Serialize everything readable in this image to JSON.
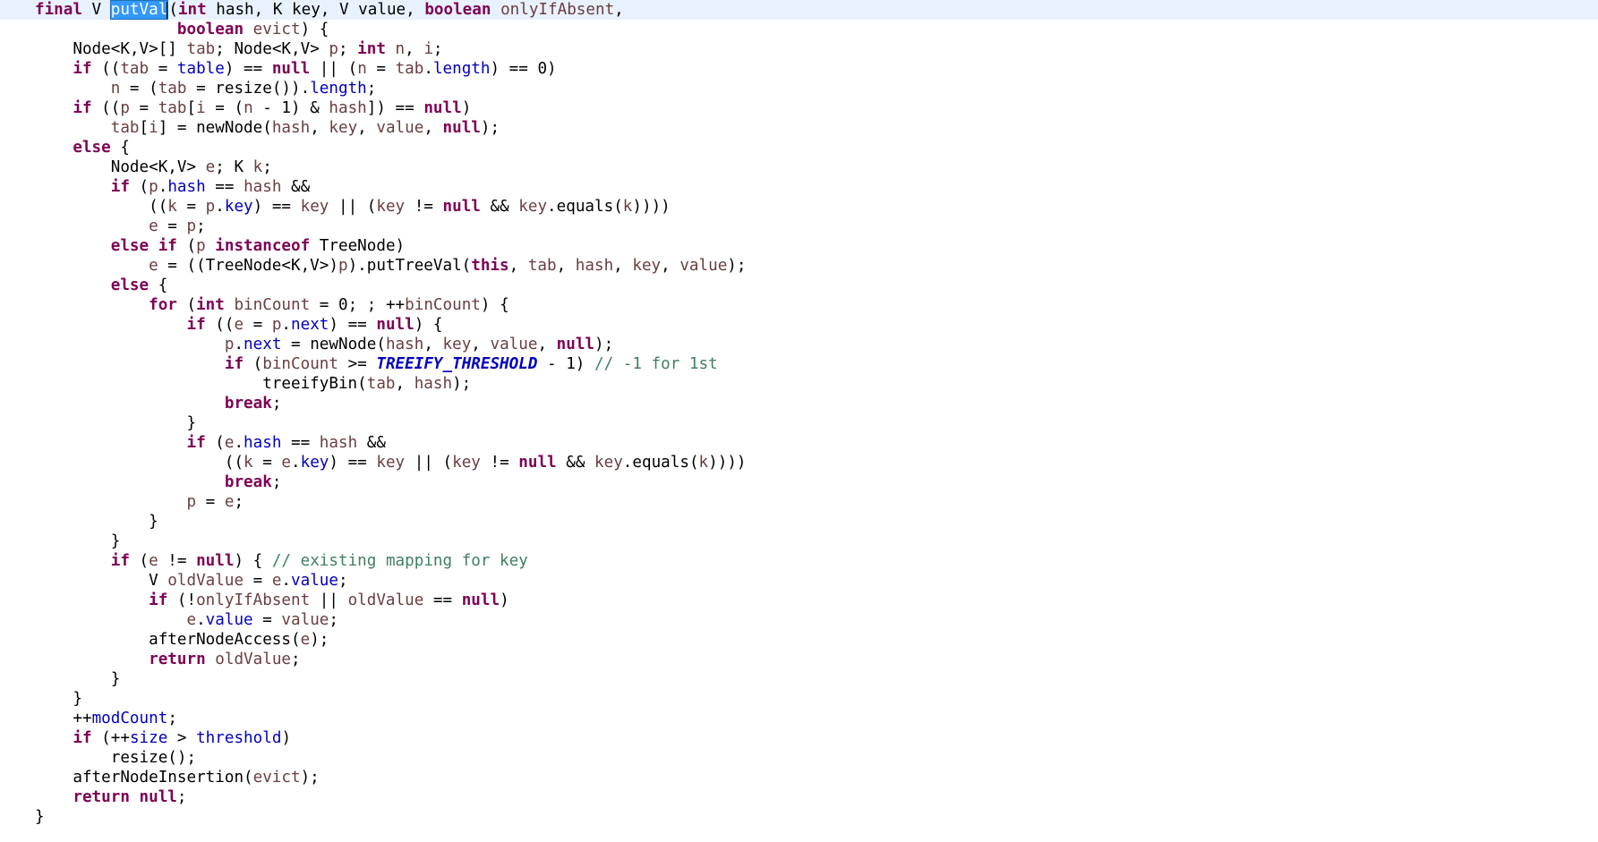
{
  "editor": {
    "colors": {
      "background": "#ffffff",
      "current_line": "#e8f2fe",
      "keyword": "#7f0055",
      "field": "#0000c0",
      "parameter": "#6a3e3e",
      "comment": "#3f7f5f",
      "selection": "#3399ff"
    },
    "current_line_index": 0,
    "selected_text": "putVal",
    "lines": [
      [
        {
          "t": "final",
          "c": "kw"
        },
        {
          "t": " V "
        },
        {
          "t": "putVal",
          "c": "sel"
        },
        {
          "t": "",
          "c": "caret"
        },
        {
          "t": "("
        },
        {
          "t": "int",
          "c": "kw"
        },
        {
          "t": " hash, K key, V value, "
        },
        {
          "t": "boolean",
          "c": "kw"
        },
        {
          "t": " "
        },
        {
          "t": "onlyIfAbsent",
          "c": "param"
        },
        {
          "t": ","
        }
      ],
      [
        {
          "t": "               "
        },
        {
          "t": "boolean",
          "c": "kw"
        },
        {
          "t": " "
        },
        {
          "t": "evict",
          "c": "param"
        },
        {
          "t": ") {"
        }
      ],
      [
        {
          "t": "    Node<K,V>[] "
        },
        {
          "t": "tab",
          "c": "param"
        },
        {
          "t": "; Node<K,V> "
        },
        {
          "t": "p",
          "c": "param"
        },
        {
          "t": "; "
        },
        {
          "t": "int",
          "c": "kw"
        },
        {
          "t": " "
        },
        {
          "t": "n",
          "c": "param"
        },
        {
          "t": ", "
        },
        {
          "t": "i",
          "c": "param"
        },
        {
          "t": ";"
        }
      ],
      [
        {
          "t": "    "
        },
        {
          "t": "if",
          "c": "kw"
        },
        {
          "t": " (("
        },
        {
          "t": "tab",
          "c": "param"
        },
        {
          "t": " = "
        },
        {
          "t": "table",
          "c": "field"
        },
        {
          "t": ") == "
        },
        {
          "t": "null",
          "c": "kw"
        },
        {
          "t": " || ("
        },
        {
          "t": "n",
          "c": "param"
        },
        {
          "t": " = "
        },
        {
          "t": "tab",
          "c": "param"
        },
        {
          "t": "."
        },
        {
          "t": "length",
          "c": "field"
        },
        {
          "t": ") == 0)"
        }
      ],
      [
        {
          "t": "        "
        },
        {
          "t": "n",
          "c": "param"
        },
        {
          "t": " = ("
        },
        {
          "t": "tab",
          "c": "param"
        },
        {
          "t": " = resize())."
        },
        {
          "t": "length",
          "c": "field"
        },
        {
          "t": ";"
        }
      ],
      [
        {
          "t": "    "
        },
        {
          "t": "if",
          "c": "kw"
        },
        {
          "t": " (("
        },
        {
          "t": "p",
          "c": "param"
        },
        {
          "t": " = "
        },
        {
          "t": "tab",
          "c": "param"
        },
        {
          "t": "["
        },
        {
          "t": "i",
          "c": "param"
        },
        {
          "t": " = ("
        },
        {
          "t": "n",
          "c": "param"
        },
        {
          "t": " - 1) & "
        },
        {
          "t": "hash",
          "c": "param"
        },
        {
          "t": "]) == "
        },
        {
          "t": "null",
          "c": "kw"
        },
        {
          "t": ")"
        }
      ],
      [
        {
          "t": "        "
        },
        {
          "t": "tab",
          "c": "param"
        },
        {
          "t": "["
        },
        {
          "t": "i",
          "c": "param"
        },
        {
          "t": "] = newNode("
        },
        {
          "t": "hash",
          "c": "param"
        },
        {
          "t": ", "
        },
        {
          "t": "key",
          "c": "param"
        },
        {
          "t": ", "
        },
        {
          "t": "value",
          "c": "param"
        },
        {
          "t": ", "
        },
        {
          "t": "null",
          "c": "kw"
        },
        {
          "t": ");"
        }
      ],
      [
        {
          "t": "    "
        },
        {
          "t": "else",
          "c": "kw"
        },
        {
          "t": " {"
        }
      ],
      [
        {
          "t": "        Node<K,V> "
        },
        {
          "t": "e",
          "c": "param"
        },
        {
          "t": "; K "
        },
        {
          "t": "k",
          "c": "param"
        },
        {
          "t": ";"
        }
      ],
      [
        {
          "t": "        "
        },
        {
          "t": "if",
          "c": "kw"
        },
        {
          "t": " ("
        },
        {
          "t": "p",
          "c": "param"
        },
        {
          "t": "."
        },
        {
          "t": "hash",
          "c": "field"
        },
        {
          "t": " == "
        },
        {
          "t": "hash",
          "c": "param"
        },
        {
          "t": " &&"
        }
      ],
      [
        {
          "t": "            (("
        },
        {
          "t": "k",
          "c": "param"
        },
        {
          "t": " = "
        },
        {
          "t": "p",
          "c": "param"
        },
        {
          "t": "."
        },
        {
          "t": "key",
          "c": "field"
        },
        {
          "t": ") == "
        },
        {
          "t": "key",
          "c": "param"
        },
        {
          "t": " || ("
        },
        {
          "t": "key",
          "c": "param"
        },
        {
          "t": " != "
        },
        {
          "t": "null",
          "c": "kw"
        },
        {
          "t": " && "
        },
        {
          "t": "key",
          "c": "param"
        },
        {
          "t": ".equals("
        },
        {
          "t": "k",
          "c": "param"
        },
        {
          "t": "))))"
        }
      ],
      [
        {
          "t": "            "
        },
        {
          "t": "e",
          "c": "param"
        },
        {
          "t": " = "
        },
        {
          "t": "p",
          "c": "param"
        },
        {
          "t": ";"
        }
      ],
      [
        {
          "t": "        "
        },
        {
          "t": "else",
          "c": "kw"
        },
        {
          "t": " "
        },
        {
          "t": "if",
          "c": "kw"
        },
        {
          "t": " ("
        },
        {
          "t": "p",
          "c": "param"
        },
        {
          "t": " "
        },
        {
          "t": "instanceof",
          "c": "kw"
        },
        {
          "t": " TreeNode)"
        }
      ],
      [
        {
          "t": "            "
        },
        {
          "t": "e",
          "c": "param"
        },
        {
          "t": " = ((TreeNode<K,V>)"
        },
        {
          "t": "p",
          "c": "param"
        },
        {
          "t": ").putTreeVal("
        },
        {
          "t": "this",
          "c": "kw"
        },
        {
          "t": ", "
        },
        {
          "t": "tab",
          "c": "param"
        },
        {
          "t": ", "
        },
        {
          "t": "hash",
          "c": "param"
        },
        {
          "t": ", "
        },
        {
          "t": "key",
          "c": "param"
        },
        {
          "t": ", "
        },
        {
          "t": "value",
          "c": "param"
        },
        {
          "t": ");"
        }
      ],
      [
        {
          "t": "        "
        },
        {
          "t": "else",
          "c": "kw"
        },
        {
          "t": " {"
        }
      ],
      [
        {
          "t": "            "
        },
        {
          "t": "for",
          "c": "kw"
        },
        {
          "t": " ("
        },
        {
          "t": "int",
          "c": "kw"
        },
        {
          "t": " "
        },
        {
          "t": "binCount",
          "c": "param"
        },
        {
          "t": " = 0; ; ++"
        },
        {
          "t": "binCount",
          "c": "param"
        },
        {
          "t": ") {"
        }
      ],
      [
        {
          "t": "                "
        },
        {
          "t": "if",
          "c": "kw"
        },
        {
          "t": " (("
        },
        {
          "t": "e",
          "c": "param"
        },
        {
          "t": " = "
        },
        {
          "t": "p",
          "c": "param"
        },
        {
          "t": "."
        },
        {
          "t": "next",
          "c": "field"
        },
        {
          "t": ") == "
        },
        {
          "t": "null",
          "c": "kw"
        },
        {
          "t": ") {"
        }
      ],
      [
        {
          "t": "                    "
        },
        {
          "t": "p",
          "c": "param"
        },
        {
          "t": "."
        },
        {
          "t": "next",
          "c": "field"
        },
        {
          "t": " = newNode("
        },
        {
          "t": "hash",
          "c": "param"
        },
        {
          "t": ", "
        },
        {
          "t": "key",
          "c": "param"
        },
        {
          "t": ", "
        },
        {
          "t": "value",
          "c": "param"
        },
        {
          "t": ", "
        },
        {
          "t": "null",
          "c": "kw"
        },
        {
          "t": ");"
        }
      ],
      [
        {
          "t": "                    "
        },
        {
          "t": "if",
          "c": "kw"
        },
        {
          "t": " ("
        },
        {
          "t": "binCount",
          "c": "param"
        },
        {
          "t": " >= "
        },
        {
          "t": "TREEIFY_THRESHOLD",
          "c": "const"
        },
        {
          "t": " - 1) "
        },
        {
          "t": "// -1 for 1st",
          "c": "comment"
        }
      ],
      [
        {
          "t": "                        treeifyBin("
        },
        {
          "t": "tab",
          "c": "param"
        },
        {
          "t": ", "
        },
        {
          "t": "hash",
          "c": "param"
        },
        {
          "t": ");"
        }
      ],
      [
        {
          "t": "                    "
        },
        {
          "t": "break",
          "c": "kw"
        },
        {
          "t": ";"
        }
      ],
      [
        {
          "t": "                }"
        }
      ],
      [
        {
          "t": "                "
        },
        {
          "t": "if",
          "c": "kw"
        },
        {
          "t": " ("
        },
        {
          "t": "e",
          "c": "param"
        },
        {
          "t": "."
        },
        {
          "t": "hash",
          "c": "field"
        },
        {
          "t": " == "
        },
        {
          "t": "hash",
          "c": "param"
        },
        {
          "t": " &&"
        }
      ],
      [
        {
          "t": "                    (("
        },
        {
          "t": "k",
          "c": "param"
        },
        {
          "t": " = "
        },
        {
          "t": "e",
          "c": "param"
        },
        {
          "t": "."
        },
        {
          "t": "key",
          "c": "field"
        },
        {
          "t": ") == "
        },
        {
          "t": "key",
          "c": "param"
        },
        {
          "t": " || ("
        },
        {
          "t": "key",
          "c": "param"
        },
        {
          "t": " != "
        },
        {
          "t": "null",
          "c": "kw"
        },
        {
          "t": " && "
        },
        {
          "t": "key",
          "c": "param"
        },
        {
          "t": ".equals("
        },
        {
          "t": "k",
          "c": "param"
        },
        {
          "t": "))))"
        }
      ],
      [
        {
          "t": "                    "
        },
        {
          "t": "break",
          "c": "kw"
        },
        {
          "t": ";"
        }
      ],
      [
        {
          "t": "                "
        },
        {
          "t": "p",
          "c": "param"
        },
        {
          "t": " = "
        },
        {
          "t": "e",
          "c": "param"
        },
        {
          "t": ";"
        }
      ],
      [
        {
          "t": "            }"
        }
      ],
      [
        {
          "t": "        }"
        }
      ],
      [
        {
          "t": "        "
        },
        {
          "t": "if",
          "c": "kw"
        },
        {
          "t": " ("
        },
        {
          "t": "e",
          "c": "param"
        },
        {
          "t": " != "
        },
        {
          "t": "null",
          "c": "kw"
        },
        {
          "t": ") { "
        },
        {
          "t": "// existing mapping for key",
          "c": "comment"
        }
      ],
      [
        {
          "t": "            V "
        },
        {
          "t": "oldValue",
          "c": "param"
        },
        {
          "t": " = "
        },
        {
          "t": "e",
          "c": "param"
        },
        {
          "t": "."
        },
        {
          "t": "value",
          "c": "field"
        },
        {
          "t": ";"
        }
      ],
      [
        {
          "t": "            "
        },
        {
          "t": "if",
          "c": "kw"
        },
        {
          "t": " (!"
        },
        {
          "t": "onlyIfAbsent",
          "c": "param"
        },
        {
          "t": " || "
        },
        {
          "t": "oldValue",
          "c": "param"
        },
        {
          "t": " == "
        },
        {
          "t": "null",
          "c": "kw"
        },
        {
          "t": ")"
        }
      ],
      [
        {
          "t": "                "
        },
        {
          "t": "e",
          "c": "param"
        },
        {
          "t": "."
        },
        {
          "t": "value",
          "c": "field"
        },
        {
          "t": " = "
        },
        {
          "t": "value",
          "c": "param"
        },
        {
          "t": ";"
        }
      ],
      [
        {
          "t": "            afterNodeAccess("
        },
        {
          "t": "e",
          "c": "param"
        },
        {
          "t": ");"
        }
      ],
      [
        {
          "t": "            "
        },
        {
          "t": "return",
          "c": "kw"
        },
        {
          "t": " "
        },
        {
          "t": "oldValue",
          "c": "param"
        },
        {
          "t": ";"
        }
      ],
      [
        {
          "t": "        }"
        }
      ],
      [
        {
          "t": "    }"
        }
      ],
      [
        {
          "t": "    ++"
        },
        {
          "t": "modCount",
          "c": "field"
        },
        {
          "t": ";"
        }
      ],
      [
        {
          "t": "    "
        },
        {
          "t": "if",
          "c": "kw"
        },
        {
          "t": " (++"
        },
        {
          "t": "size",
          "c": "field"
        },
        {
          "t": " > "
        },
        {
          "t": "threshold",
          "c": "field"
        },
        {
          "t": ")"
        }
      ],
      [
        {
          "t": "        resize();"
        }
      ],
      [
        {
          "t": "    afterNodeInsertion("
        },
        {
          "t": "evict",
          "c": "param"
        },
        {
          "t": ");"
        }
      ],
      [
        {
          "t": "    "
        },
        {
          "t": "return",
          "c": "kw"
        },
        {
          "t": " "
        },
        {
          "t": "null",
          "c": "kw"
        },
        {
          "t": ";"
        }
      ],
      [
        {
          "t": "}"
        }
      ]
    ]
  }
}
